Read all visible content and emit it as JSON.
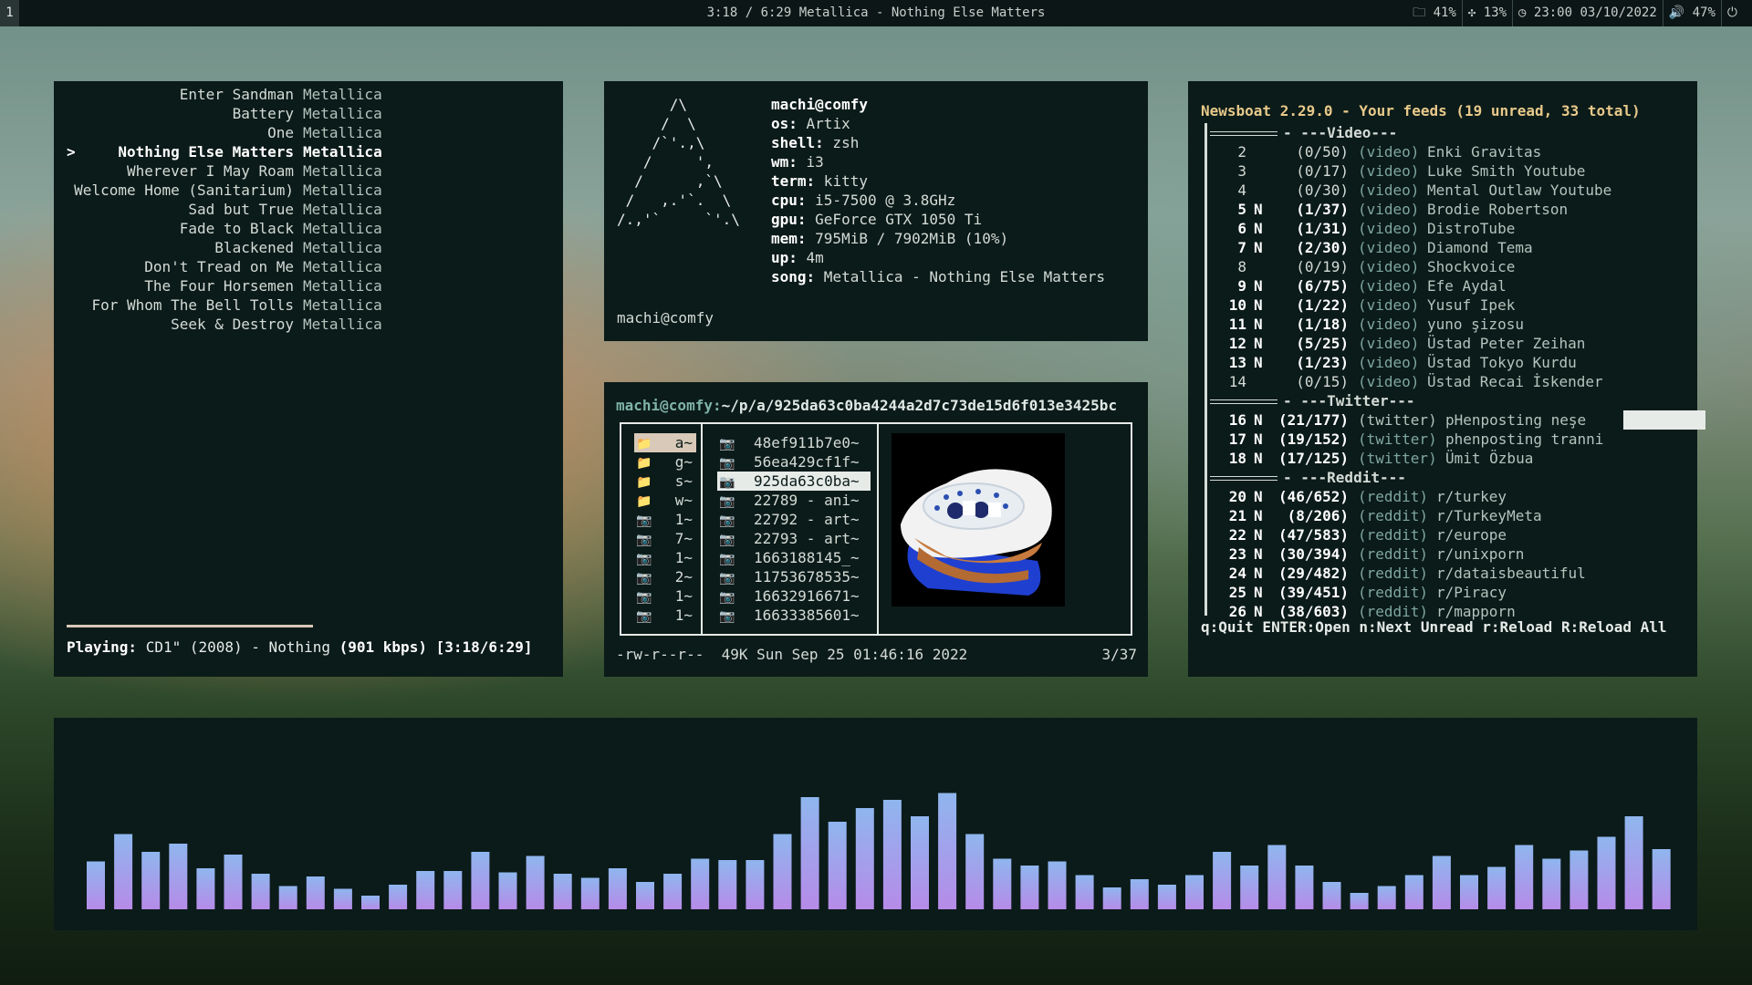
{
  "bar": {
    "workspace": "1",
    "title": "3:18 / 6:29 Metallica - Nothing Else Matters",
    "status": [
      {
        "icon": "folder-icon",
        "text": "41%"
      },
      {
        "icon": "fan-icon",
        "text": "13%"
      },
      {
        "icon": "clock-icon",
        "text": "23:00 03/10/2022"
      },
      {
        "icon": "volume-icon",
        "text": "47%"
      },
      {
        "icon": "power-icon",
        "text": ""
      }
    ]
  },
  "cmus": {
    "marker": ">",
    "tracks": [
      {
        "title": "Enter Sandman",
        "artist": "Metallica"
      },
      {
        "title": "Battery",
        "artist": "Metallica"
      },
      {
        "title": "One",
        "artist": "Metallica"
      },
      {
        "title": "Nothing Else Matters",
        "artist": "Metallica"
      },
      {
        "title": "Wherever I May Roam",
        "artist": "Metallica"
      },
      {
        "title": "Welcome Home (Sanitarium)",
        "artist": "Metallica"
      },
      {
        "title": "Sad but True",
        "artist": "Metallica"
      },
      {
        "title": "Fade to Black",
        "artist": "Metallica"
      },
      {
        "title": "Blackened",
        "artist": "Metallica"
      },
      {
        "title": "Don't Tread on Me",
        "artist": "Metallica"
      },
      {
        "title": "The Four Horsemen",
        "artist": "Metallica"
      },
      {
        "title": "For Whom The Bell Tolls",
        "artist": "Metallica"
      },
      {
        "title": "Seek & Destroy",
        "artist": "Metallica"
      }
    ],
    "current_index": 3,
    "progress": 0.51,
    "playing_label": "Playing:",
    "playing_info": " CD1\" (2008) - Nothing ",
    "bitrate": "(901 kbps) [3:18/6:29]"
  },
  "neofetch": {
    "logo": "      /\\\n     /  \\\n    /`'.,\\\n   /     ',\n  /      ,`\\\n /   ,.'`.  \\\n/.,'`     `'.\\",
    "header": "machi@comfy",
    "info": [
      {
        "key": "os:",
        "value": " Artix"
      },
      {
        "key": "shell:",
        "value": " zsh"
      },
      {
        "key": "wm:",
        "value": " i3"
      },
      {
        "key": "term:",
        "value": " kitty"
      },
      {
        "key": "cpu:",
        "value": " i5-7500 @ 3.8GHz"
      },
      {
        "key": "gpu:",
        "value": " GeForce GTX 1050 Ti"
      },
      {
        "key": "mem:",
        "value": " 795MiB / 7902MiB (10%)"
      },
      {
        "key": "up:",
        "value": " 4m"
      },
      {
        "key": "song:",
        "value": " Metallica - Nothing Else Matters"
      }
    ],
    "prompt": "machi@comfy"
  },
  "ranger": {
    "host": "machi@comfy:",
    "dir": "~/p/a/925da63c0ba4244a2d7c73de15d6f013e3425bc",
    "parent": [
      {
        "icon": "folder-icon",
        "name": "a~",
        "selected": true
      },
      {
        "icon": "folder-icon",
        "name": "g~"
      },
      {
        "icon": "folder-icon",
        "name": "s~"
      },
      {
        "icon": "folder-icon",
        "name": "w~"
      },
      {
        "icon": "image-icon",
        "name": "1~"
      },
      {
        "icon": "image-icon",
        "name": "7~"
      },
      {
        "icon": "image-icon",
        "name": "1~"
      },
      {
        "icon": "image-icon",
        "name": "2~"
      },
      {
        "icon": "image-icon",
        "name": "1~"
      },
      {
        "icon": "image-icon",
        "name": "1~"
      }
    ],
    "files": [
      {
        "name": "48ef911b7e0~"
      },
      {
        "name": "56ea429cf1f~"
      },
      {
        "name": "925da63c0ba~",
        "selected": true
      },
      {
        "name": "22789 - ani~"
      },
      {
        "name": "22792 - art~"
      },
      {
        "name": "22793 - art~"
      },
      {
        "name": "1663188145_~"
      },
      {
        "name": "11753678535~"
      },
      {
        "name": "16632916671~"
      },
      {
        "name": "16633385601~"
      }
    ],
    "footer": "-rw-r--r--  49K Sun Sep 25 01:46:16 2022",
    "position": "3/37"
  },
  "newsboat": {
    "header": "Newsboat 2.29.0 - Your feeds (19 unread, 33 total)",
    "groups": [
      "---Video---",
      "---Twitter---",
      "---Reddit---"
    ],
    "feeds": [
      {
        "num": "2",
        "flag": "",
        "count": "(0/50)",
        "cat": "(video)",
        "title": "Enki Gravitas",
        "group": 0
      },
      {
        "num": "3",
        "flag": "",
        "count": "(0/17)",
        "cat": "(video)",
        "title": "Luke Smith Youtube",
        "group": 0
      },
      {
        "num": "4",
        "flag": "",
        "count": "(0/30)",
        "cat": "(video)",
        "title": "Mental Outlaw Youtube",
        "group": 0
      },
      {
        "num": "5",
        "flag": "N",
        "count": "(1/37)",
        "cat": "(video)",
        "title": "Brodie Robertson",
        "group": 0
      },
      {
        "num": "6",
        "flag": "N",
        "count": "(1/31)",
        "cat": "(video)",
        "title": "DistroTube",
        "group": 0
      },
      {
        "num": "7",
        "flag": "N",
        "count": "(2/30)",
        "cat": "(video)",
        "title": "Diamond Tema",
        "group": 0
      },
      {
        "num": "8",
        "flag": "",
        "count": "(0/19)",
        "cat": "(video)",
        "title": "Shockvoice",
        "group": 0
      },
      {
        "num": "9",
        "flag": "N",
        "count": "(6/75)",
        "cat": "(video)",
        "title": "Efe Aydal",
        "group": 0
      },
      {
        "num": "10",
        "flag": "N",
        "count": "(1/22)",
        "cat": "(video)",
        "title": "Yusuf Ipek",
        "group": 0
      },
      {
        "num": "11",
        "flag": "N",
        "count": "(1/18)",
        "cat": "(video)",
        "title": "yuno şizosu",
        "group": 0
      },
      {
        "num": "12",
        "flag": "N",
        "count": "(5/25)",
        "cat": "(video)",
        "title": "Üstad Peter Zeihan",
        "group": 0
      },
      {
        "num": "13",
        "flag": "N",
        "count": "(1/23)",
        "cat": "(video)",
        "title": "Üstad Tokyo Kurdu",
        "group": 0
      },
      {
        "num": "14",
        "flag": "",
        "count": "(0/15)",
        "cat": "(video)",
        "title": "Üstad Recai İskender",
        "group": 0
      },
      {
        "num": "16",
        "flag": "N",
        "count": "(21/177)",
        "cat": "(twitter)",
        "title": "pHenposting neşe",
        "group": 1,
        "selected": true
      },
      {
        "num": "17",
        "flag": "N",
        "count": "(19/152)",
        "cat": "(twitter)",
        "title": "phenposting tranni",
        "group": 1
      },
      {
        "num": "18",
        "flag": "N",
        "count": "(17/125)",
        "cat": "(twitter)",
        "title": "Ümit Özbua",
        "group": 1
      },
      {
        "num": "20",
        "flag": "N",
        "count": "(46/652)",
        "cat": "(reddit)",
        "title": "r/turkey",
        "group": 2
      },
      {
        "num": "21",
        "flag": "N",
        "count": " (8/206)",
        "cat": "(reddit)",
        "title": "r/TurkeyMeta",
        "group": 2
      },
      {
        "num": "22",
        "flag": "N",
        "count": "(47/583)",
        "cat": "(reddit)",
        "title": "r/europe",
        "group": 2
      },
      {
        "num": "23",
        "flag": "N",
        "count": "(30/394)",
        "cat": "(reddit)",
        "title": "r/unixporn",
        "group": 2
      },
      {
        "num": "24",
        "flag": "N",
        "count": "(29/482)",
        "cat": "(reddit)",
        "title": "r/dataisbeautiful",
        "group": 2
      },
      {
        "num": "25",
        "flag": "N",
        "count": "(39/451)",
        "cat": "(reddit)",
        "title": "r/Piracy",
        "group": 2
      },
      {
        "num": "26",
        "flag": "N",
        "count": "(38/603)",
        "cat": "(reddit)",
        "title": "r/mapporn",
        "group": 2
      }
    ],
    "footer": "q:Quit ENTER:Open n:Next Unread r:Reload R:Reload All"
  },
  "visualizer": {
    "colors": {
      "top": "#8fb6ee",
      "bottom": "#b68be8"
    },
    "levels": [
      0.35,
      0.55,
      0.42,
      0.48,
      0.3,
      0.4,
      0.26,
      0.17,
      0.24,
      0.15,
      0.1,
      0.18,
      0.28,
      0.28,
      0.42,
      0.27,
      0.39,
      0.26,
      0.23,
      0.3,
      0.2,
      0.26,
      0.37,
      0.36,
      0.36,
      0.55,
      0.82,
      0.64,
      0.74,
      0.8,
      0.68,
      0.85,
      0.55,
      0.37,
      0.32,
      0.35,
      0.25,
      0.16,
      0.22,
      0.18,
      0.25,
      0.42,
      0.32,
      0.47,
      0.32,
      0.2,
      0.12,
      0.17,
      0.25,
      0.39,
      0.25,
      0.31,
      0.47,
      0.37,
      0.43,
      0.53,
      0.68,
      0.44
    ]
  }
}
